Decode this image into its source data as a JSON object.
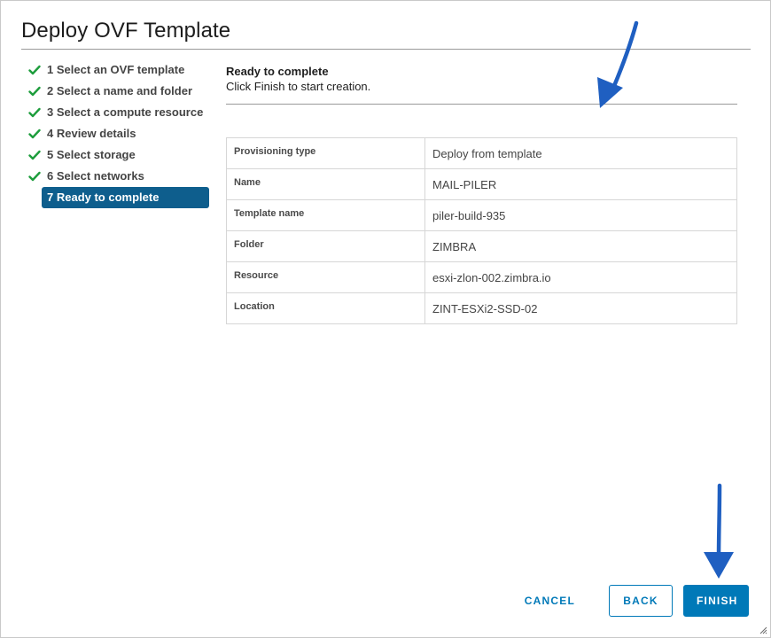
{
  "dialog": {
    "title": "Deploy OVF Template"
  },
  "steps": [
    {
      "label": "1 Select an OVF template",
      "status": "done"
    },
    {
      "label": "2 Select a name and folder",
      "status": "done"
    },
    {
      "label": "3 Select a compute resource",
      "status": "done"
    },
    {
      "label": "4 Review details",
      "status": "done"
    },
    {
      "label": "5 Select storage",
      "status": "done"
    },
    {
      "label": "6 Select networks",
      "status": "done"
    },
    {
      "label": "7 Ready to complete",
      "status": "active"
    }
  ],
  "content": {
    "heading": "Ready to complete",
    "subtitle": "Click Finish to start creation."
  },
  "summary": [
    {
      "key": "Provisioning type",
      "value": "Deploy from template"
    },
    {
      "key": "Name",
      "value": "MAIL-PILER"
    },
    {
      "key": "Template name",
      "value": "piler-build-935"
    },
    {
      "key": "Folder",
      "value": "ZIMBRA"
    },
    {
      "key": "Resource",
      "value": "esxi-zlon-002.zimbra.io"
    },
    {
      "key": "Location",
      "value": "ZINT-ESXi2-SSD-02"
    }
  ],
  "buttons": {
    "cancel": "CANCEL",
    "back": "BACK",
    "finish": "FINISH"
  },
  "icons": {
    "step_done": "check-icon",
    "grip": "resize-grip-icon",
    "annotation": "arrow-annotation-icon"
  },
  "colors": {
    "check": "#1d9d3c",
    "active_step": "#0e5e8d",
    "primary": "#0079b8",
    "annotation": "#1f5fc1"
  }
}
